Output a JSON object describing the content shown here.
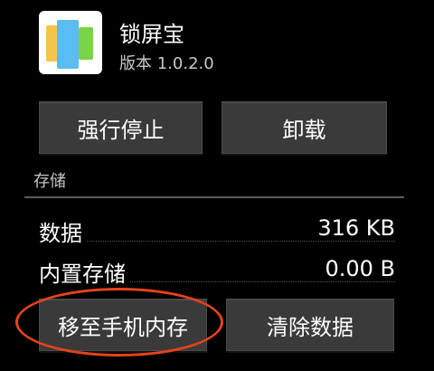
{
  "app": {
    "name": "锁屏宝",
    "version": "版本 1.0.2.0",
    "icon": "lockscreen-app-icon",
    "icon_colors": [
      "#f4c54a",
      "#5bbcf0",
      "#7bd34a"
    ]
  },
  "actions": {
    "force_stop_label": "强行停止",
    "uninstall_label": "卸载"
  },
  "storage": {
    "section_title": "存储",
    "rows": [
      {
        "label": "数据",
        "value": "316 KB"
      },
      {
        "label": "内置存储",
        "value": "0.00 B"
      }
    ],
    "move_label": "移至手机内存",
    "clear_data_label": "清除数据"
  },
  "colors": {
    "background": "#000000",
    "button": "#3a3a3a",
    "highlight": "#e8421a"
  }
}
